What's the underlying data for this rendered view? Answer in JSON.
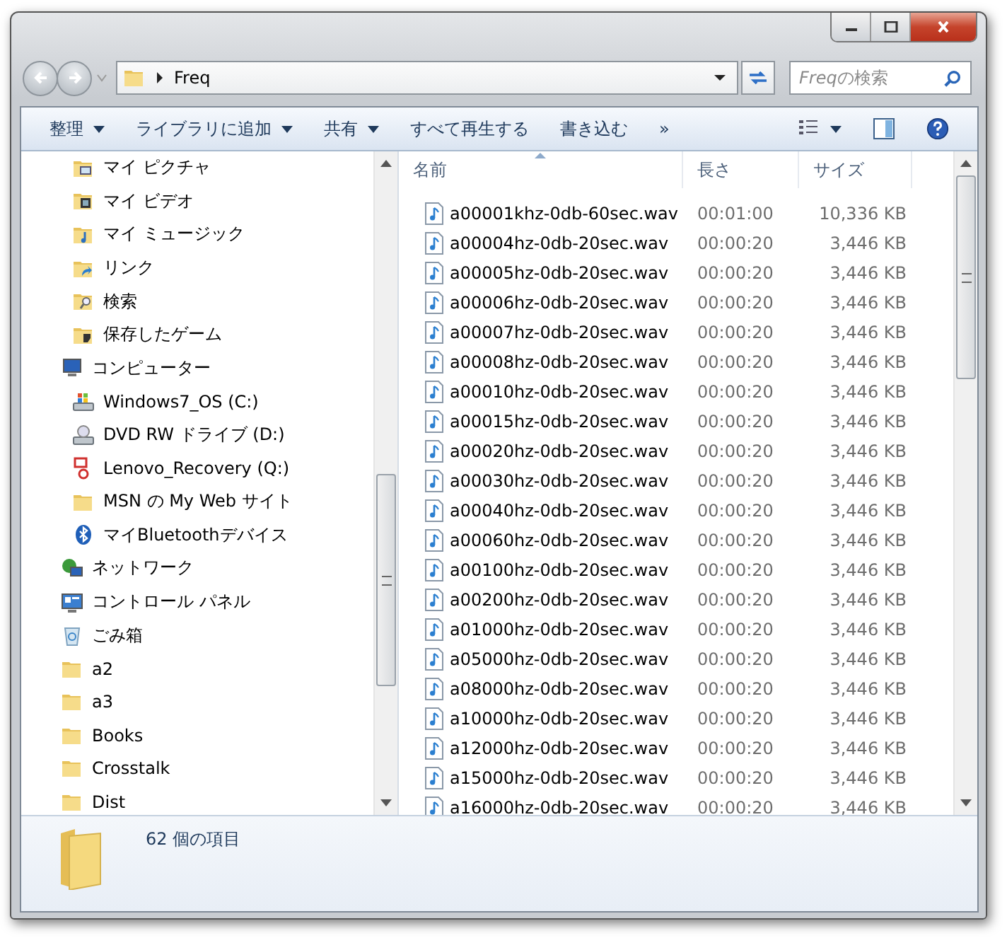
{
  "address": {
    "breadcrumb": [
      "Freq"
    ]
  },
  "search": {
    "placeholder_emph": "Freq",
    "placeholder": "の検索"
  },
  "toolbar": {
    "items": [
      {
        "label": "整理",
        "dropdown": true
      },
      {
        "label": "ライブラリに追加",
        "dropdown": true
      },
      {
        "label": "共有",
        "dropdown": true
      },
      {
        "label": "すべて再生する",
        "dropdown": false
      },
      {
        "label": "書き込む",
        "dropdown": false
      },
      {
        "label": "»",
        "dropdown": false
      }
    ]
  },
  "sidebar": {
    "items": [
      {
        "children": [
          {
            "label": "マイ ピクチャ",
            "kind": "pictures"
          },
          {
            "label": "マイ ビデオ",
            "kind": "videos"
          },
          {
            "label": "マイ ミュージック",
            "kind": "music"
          },
          {
            "label": "リンク",
            "kind": "links"
          },
          {
            "label": "検索",
            "kind": "searches"
          },
          {
            "label": "保存したゲーム",
            "kind": "games"
          }
        ]
      },
      {
        "label": "コンピューター",
        "kind": "computer",
        "children": [
          {
            "label": "Windows7_OS (C:)",
            "kind": "systemdrive"
          },
          {
            "label": "DVD RW ドライブ (D:)",
            "kind": "dvd"
          },
          {
            "label": "Lenovo_Recovery (Q:)",
            "kind": "recovery"
          },
          {
            "label": "MSN の My Web サイト",
            "kind": "folder"
          },
          {
            "label": "マイBluetoothデバイス",
            "kind": "bluetooth"
          }
        ]
      },
      {
        "label": "ネットワーク",
        "kind": "network"
      },
      {
        "label": "コントロール パネル",
        "kind": "controlpanel"
      },
      {
        "label": "ごみ箱",
        "kind": "recyclebin"
      },
      {
        "label": "a2",
        "kind": "folder"
      },
      {
        "label": "a3",
        "kind": "folder"
      },
      {
        "label": "Books",
        "kind": "folder"
      },
      {
        "label": "Crosstalk",
        "kind": "folder"
      },
      {
        "label": "Dist",
        "kind": "folder"
      }
    ]
  },
  "table": {
    "columns": [
      {
        "label": "名前",
        "sorted": true
      },
      {
        "label": "長さ",
        "sorted": false
      },
      {
        "label": "サイズ",
        "sorted": false
      }
    ],
    "rows": [
      {
        "name": "a00001khz-0db-60sec.wav",
        "length": "00:01:00",
        "size": "10,336 KB"
      },
      {
        "name": "a00004hz-0db-20sec.wav",
        "length": "00:00:20",
        "size": "3,446 KB"
      },
      {
        "name": "a00005hz-0db-20sec.wav",
        "length": "00:00:20",
        "size": "3,446 KB"
      },
      {
        "name": "a00006hz-0db-20sec.wav",
        "length": "00:00:20",
        "size": "3,446 KB"
      },
      {
        "name": "a00007hz-0db-20sec.wav",
        "length": "00:00:20",
        "size": "3,446 KB"
      },
      {
        "name": "a00008hz-0db-20sec.wav",
        "length": "00:00:20",
        "size": "3,446 KB"
      },
      {
        "name": "a00010hz-0db-20sec.wav",
        "length": "00:00:20",
        "size": "3,446 KB"
      },
      {
        "name": "a00015hz-0db-20sec.wav",
        "length": "00:00:20",
        "size": "3,446 KB"
      },
      {
        "name": "a00020hz-0db-20sec.wav",
        "length": "00:00:20",
        "size": "3,446 KB"
      },
      {
        "name": "a00030hz-0db-20sec.wav",
        "length": "00:00:20",
        "size": "3,446 KB"
      },
      {
        "name": "a00040hz-0db-20sec.wav",
        "length": "00:00:20",
        "size": "3,446 KB"
      },
      {
        "name": "a00060hz-0db-20sec.wav",
        "length": "00:00:20",
        "size": "3,446 KB"
      },
      {
        "name": "a00100hz-0db-20sec.wav",
        "length": "00:00:20",
        "size": "3,446 KB"
      },
      {
        "name": "a00200hz-0db-20sec.wav",
        "length": "00:00:20",
        "size": "3,446 KB"
      },
      {
        "name": "a01000hz-0db-20sec.wav",
        "length": "00:00:20",
        "size": "3,446 KB"
      },
      {
        "name": "a05000hz-0db-20sec.wav",
        "length": "00:00:20",
        "size": "3,446 KB"
      },
      {
        "name": "a08000hz-0db-20sec.wav",
        "length": "00:00:20",
        "size": "3,446 KB"
      },
      {
        "name": "a10000hz-0db-20sec.wav",
        "length": "00:00:20",
        "size": "3,446 KB"
      },
      {
        "name": "a12000hz-0db-20sec.wav",
        "length": "00:00:20",
        "size": "3,446 KB"
      },
      {
        "name": "a15000hz-0db-20sec.wav",
        "length": "00:00:20",
        "size": "3,446 KB"
      },
      {
        "name": "a16000hz-0db-20sec.wav",
        "length": "00:00:20",
        "size": "3,446 KB"
      }
    ]
  },
  "status_bar": {
    "count": "62 個の項目"
  }
}
